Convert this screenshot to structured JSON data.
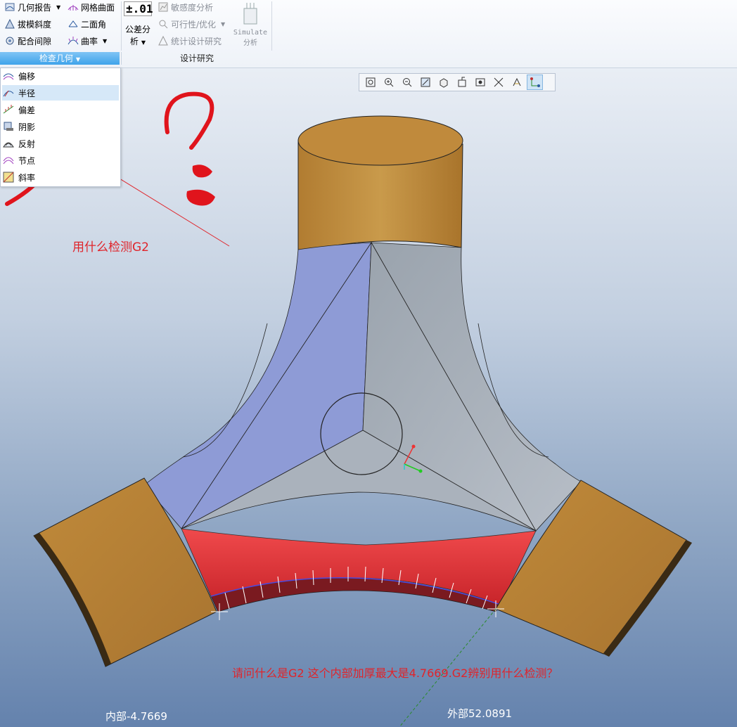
{
  "ribbon": {
    "left_group": {
      "items": [
        {
          "label": "几何报告",
          "dropdown": true,
          "icon": "geometry-report-icon"
        },
        {
          "label": "拔模斜度",
          "dropdown": false,
          "icon": "draft-angle-icon"
        },
        {
          "label": "配合间隙",
          "dropdown": false,
          "icon": "fit-clearance-icon"
        }
      ],
      "items2": [
        {
          "label": "网格曲面",
          "dropdown": false,
          "icon": "mesh-surface-icon"
        },
        {
          "label": "二面角",
          "dropdown": false,
          "icon": "dihedral-angle-icon"
        },
        {
          "label": "曲率",
          "dropdown": true,
          "icon": "curvature-icon"
        }
      ],
      "group_label": "检查几何"
    },
    "tolerance": {
      "value": "±.01",
      "label_line1": "公差分",
      "label_line2": "析"
    },
    "design_study": {
      "items": [
        {
          "label": "敏感度分析",
          "icon": "sensitivity-icon"
        },
        {
          "label": "可行性/优化",
          "icon": "feasibility-icon"
        },
        {
          "label": "统计设计研究",
          "icon": "statistics-icon"
        }
      ],
      "simulate_line1": "Simulate",
      "simulate_line2": "分析",
      "group_label": "设计研究"
    }
  },
  "menu": {
    "items": [
      {
        "label": "偏移",
        "icon": "offset-icon",
        "selected": false
      },
      {
        "label": "半径",
        "icon": "radius-icon",
        "selected": true
      },
      {
        "label": "偏差",
        "icon": "deviation-icon",
        "selected": false
      },
      {
        "label": "阴影",
        "icon": "shadow-icon",
        "selected": false
      },
      {
        "label": "反射",
        "icon": "reflection-icon",
        "selected": false
      },
      {
        "label": "节点",
        "icon": "node-icon",
        "selected": false
      },
      {
        "label": "斜率",
        "icon": "slope-icon",
        "selected": false
      }
    ]
  },
  "view_toolbar": {
    "buttons": [
      {
        "icon": "refit-icon",
        "active": false
      },
      {
        "icon": "zoom-in-icon",
        "active": false
      },
      {
        "icon": "zoom-out-icon",
        "active": false
      },
      {
        "icon": "repaint-icon",
        "active": false
      },
      {
        "icon": "display-style-icon",
        "active": false
      },
      {
        "icon": "saved-views-icon",
        "active": false
      },
      {
        "icon": "view-manager-icon",
        "active": false
      },
      {
        "icon": "datum-display-icon",
        "active": false
      },
      {
        "icon": "annotation-display-icon",
        "active": false
      },
      {
        "icon": "spin-center-icon",
        "active": true
      }
    ]
  },
  "annotations": {
    "question_g2": "用什么检测G2",
    "question_main": "请问什么是G2 这个内部加厚最大是4.7669.G2辨别用什么检测？",
    "inner_readout": "内部-4.7669",
    "outer_readout": "外部52.0891"
  },
  "colors": {
    "annotation_red": "#e0242a",
    "gold": "#c4913f",
    "blue_face": "#8e9bd6",
    "gray_face": "#a9b2bd",
    "red_region": "#e8363a",
    "ribbon_group_blue": "#3fa3ea"
  }
}
